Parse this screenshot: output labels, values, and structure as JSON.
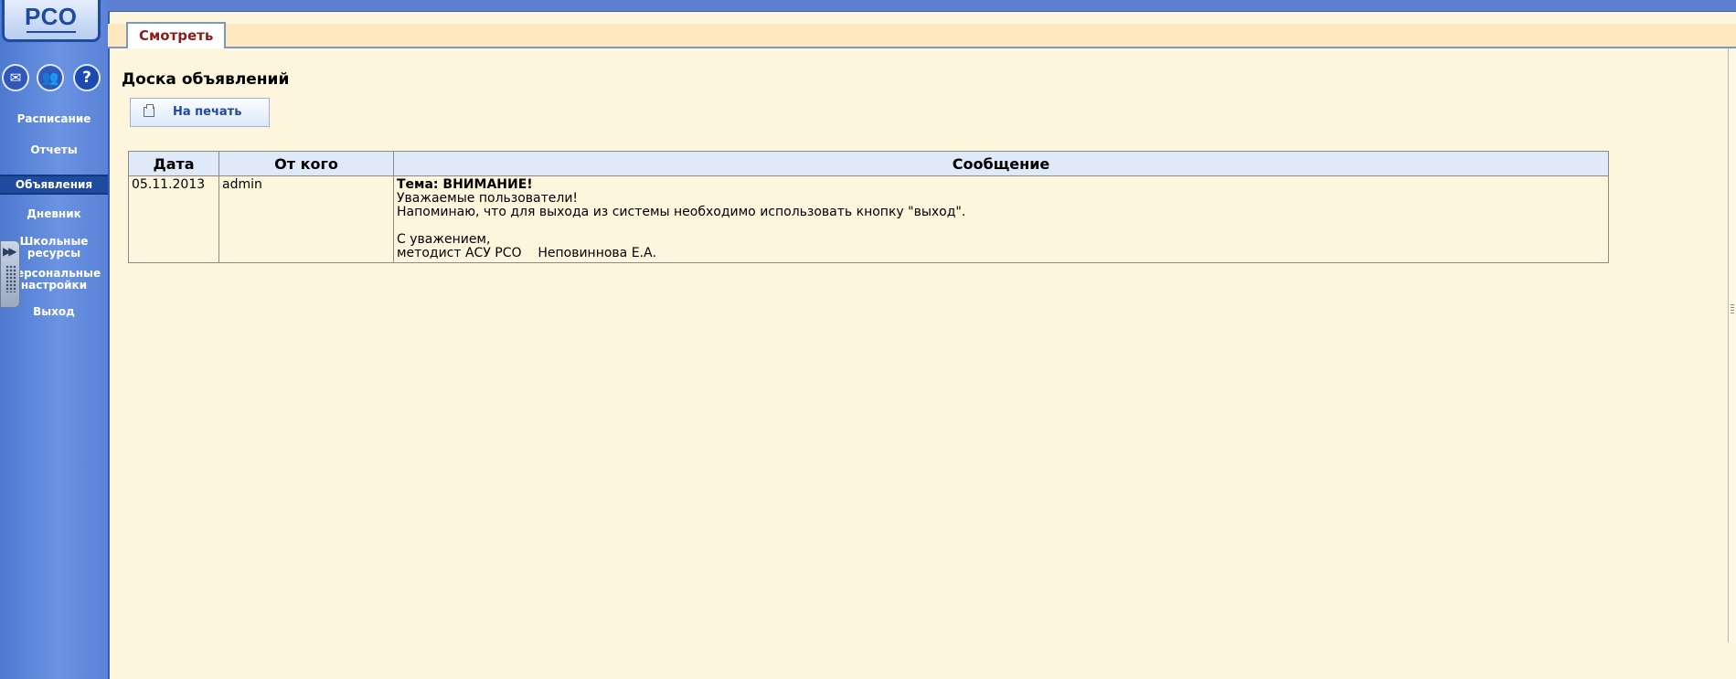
{
  "app": {
    "logo_text": "РСО"
  },
  "sidebar": {
    "icons": [
      {
        "name": "mail-icon",
        "glyph": "✉"
      },
      {
        "name": "users-icon",
        "glyph": "👥"
      },
      {
        "name": "help-icon",
        "glyph": "?"
      }
    ],
    "items": [
      {
        "label": "Расписание",
        "active": false
      },
      {
        "label": "Отчеты",
        "active": false
      },
      {
        "label": "Объявления",
        "active": true
      },
      {
        "label": "Дневник",
        "active": false
      },
      {
        "label_line1": "Школьные",
        "label_line2": "ресурсы",
        "active": false
      },
      {
        "label_line1": "Персональные",
        "label_line2": "настройки",
        "active": false
      },
      {
        "label": "Выход",
        "active": false
      }
    ],
    "handle_glyph": "▶▶"
  },
  "tabs": [
    {
      "label": "Смотреть",
      "active": true
    }
  ],
  "main": {
    "title": "Доска объявлений",
    "print_button_label": "На печать"
  },
  "table": {
    "headers": [
      "Дата",
      "От кого",
      "Сообщение"
    ],
    "rows": [
      {
        "date": "05.11.2013",
        "from": "admin",
        "subject": "Тема: ВНИМАНИЕ!",
        "lines": [
          "Уважаемые пользователи!",
          "Напоминаю, что для выхода из системы необходимо использовать кнопку \"выход\"."
        ],
        "signature": [
          "С уважением,",
          "методист АСУ РСО    Неповиннова Е.А."
        ]
      }
    ]
  },
  "colors": {
    "sidebar": "#5a82d6",
    "active_nav": "#1e4aa0",
    "background": "#fdf6dc",
    "tab_text": "#8b1c1c",
    "table_header": "#dfe9f7"
  }
}
